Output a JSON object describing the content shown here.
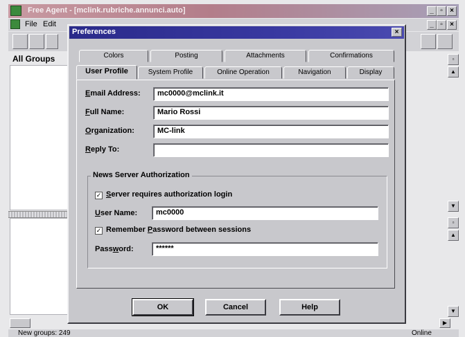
{
  "app": {
    "title": "Free Agent - [mclink.rubriche.annunci.auto]",
    "menu": [
      "File",
      "Edit"
    ],
    "all_groups_label": "All Groups",
    "status_text": "New groups: 249",
    "status_right": "Online"
  },
  "dialog": {
    "title": "Preferences",
    "close_glyph": "×",
    "tabs_back": [
      "Colors",
      "Posting",
      "Attachments",
      "Confirmations"
    ],
    "tabs_front": [
      "User Profile",
      "System Profile",
      "Online Operation",
      "Navigation",
      "Display"
    ],
    "active_tab": "User Profile",
    "fields": {
      "email": {
        "label_key": "E",
        "label_rest": "mail Address:",
        "value": "mc0000@mclink.it"
      },
      "full_name": {
        "label_key": "F",
        "label_rest": "ull Name:",
        "value": "Mario Rossi"
      },
      "organization": {
        "label_key": "O",
        "label_rest": "rganization:",
        "value": "MC-link"
      },
      "reply_to": {
        "label_key": "R",
        "label_rest": "eply To:",
        "value": ""
      }
    },
    "auth_group": {
      "title": "News Server Authorization",
      "requires_login": {
        "checked_glyph": "✓",
        "label_key": "S",
        "label_rest": "erver requires authorization login"
      },
      "user_name": {
        "label_key": "U",
        "label_rest": "ser Name:",
        "value": "mc0000"
      },
      "remember": {
        "checked_glyph": "✓",
        "pre": "Remember ",
        "label_key": "P",
        "label_rest": "assword between sessions"
      },
      "password": {
        "label_pre": "Pass",
        "label_key": "w",
        "label_rest": "ord:",
        "value": "******"
      }
    },
    "buttons": {
      "ok": "OK",
      "cancel": "Cancel",
      "help": "Help"
    }
  }
}
